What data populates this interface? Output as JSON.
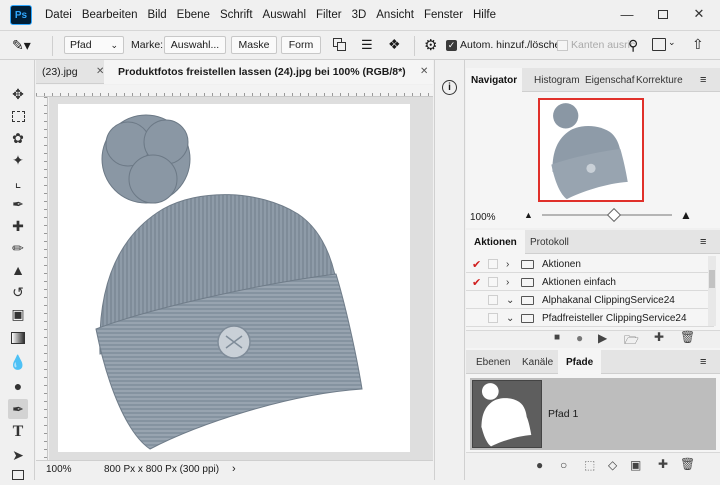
{
  "app_logo": "Ps",
  "menu": [
    "Datei",
    "Bearbeiten",
    "Bild",
    "Ebene",
    "Schrift",
    "Auswahl",
    "Filter",
    "3D",
    "Ansicht",
    "Fenster",
    "Hilfe"
  ],
  "options": {
    "mode_value": "Pfad",
    "marke_label": "Marke:",
    "auswahl_btn": "Auswahl...",
    "maske_btn": "Maske",
    "form_btn": "Form",
    "auto_add_label": "Autom. hinzuf./löschen",
    "kanten_label": "Kanten ausric"
  },
  "document": {
    "tab_prev": "(23).jpg",
    "tab_active": "Produktfotos freistellen lassen (24).jpg bei 100% (RGB/8*)",
    "zoom": "100%",
    "doc_info": "800 Px x 800 Px (300 ppi)"
  },
  "navigator": {
    "tabs": [
      "Navigator",
      "Histogram",
      "Eigenschaf",
      "Korrekture"
    ],
    "zoom": "100%",
    "zoom_level": 0.55
  },
  "actions": {
    "tabs": [
      "Aktionen",
      "Protokoll"
    ],
    "rows": [
      {
        "label": "Aktionen",
        "checked": true,
        "expanded": false
      },
      {
        "label": "Aktionen einfach",
        "checked": true,
        "expanded": false
      },
      {
        "label": "Alphakanal ClippingService24",
        "checked": false,
        "expanded": true
      },
      {
        "label": "Pfadfreisteller ClippingService24",
        "checked": false,
        "expanded": true
      }
    ]
  },
  "paths": {
    "tabs": [
      "Ebenen",
      "Kanäle",
      "Pfade"
    ],
    "path_name": "Pfad 1"
  },
  "colors": {
    "accent": "#31a8ff",
    "check": "#d01e1e",
    "nav_frame": "#e0302a",
    "hat": "#8c99a6"
  }
}
